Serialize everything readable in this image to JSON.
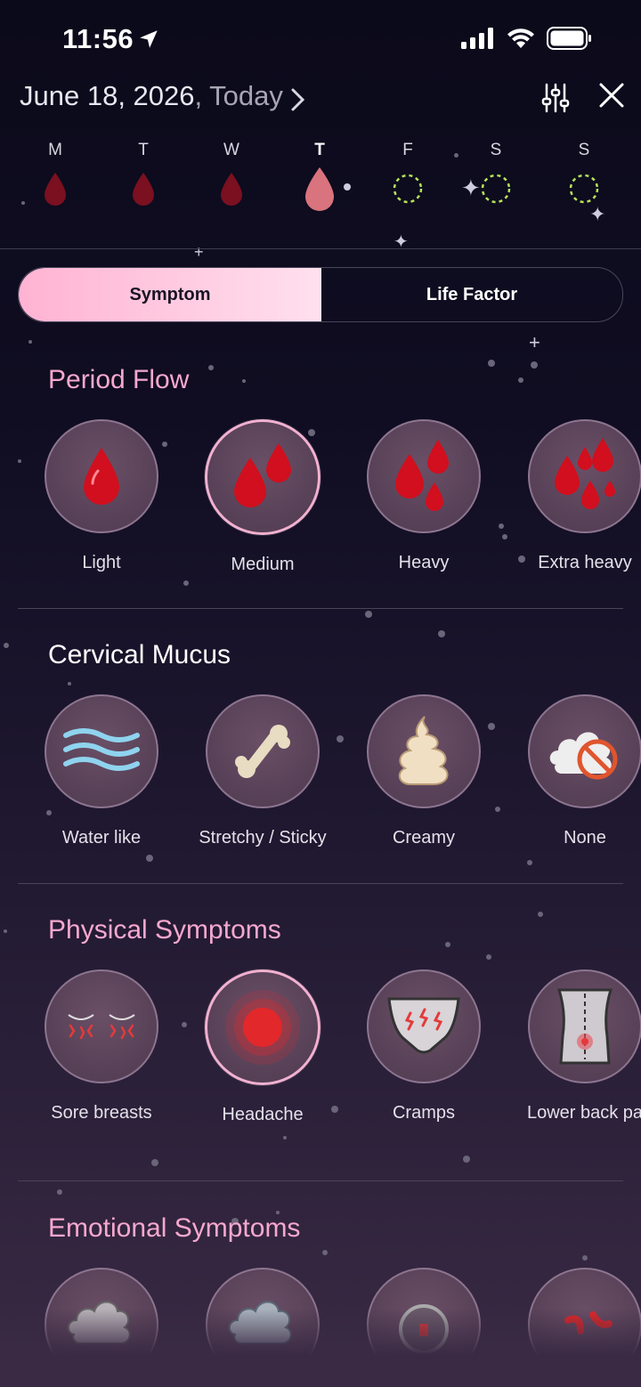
{
  "status_bar": {
    "time": "11:56"
  },
  "header": {
    "date": "June 18, 2026",
    "date_suffix": ", Today",
    "filter_icon": "sliders-icon",
    "close_icon": "close-icon"
  },
  "week": [
    {
      "letter": "M",
      "state": "period"
    },
    {
      "letter": "T",
      "state": "period"
    },
    {
      "letter": "W",
      "state": "period"
    },
    {
      "letter": "T",
      "state": "period-today"
    },
    {
      "letter": "F",
      "state": "predicted"
    },
    {
      "letter": "S",
      "state": "predicted"
    },
    {
      "letter": "S",
      "state": "predicted"
    }
  ],
  "tabs": {
    "symptom": "Symptom",
    "life_factor": "Life Factor",
    "selected": "Symptom"
  },
  "sections": {
    "period_flow": {
      "title": "Period Flow",
      "options": [
        {
          "label": "Light",
          "icon": "single-drop-icon",
          "selected": false
        },
        {
          "label": "Medium",
          "icon": "two-drops-icon",
          "selected": true
        },
        {
          "label": "Heavy",
          "icon": "three-drops-icon",
          "selected": false
        },
        {
          "label": "Extra heavy",
          "icon": "many-drops-icon",
          "selected": false
        }
      ]
    },
    "cervical_mucus": {
      "title": "Cervical Mucus",
      "options": [
        {
          "label": "Water like",
          "icon": "water-waves-icon",
          "selected": false
        },
        {
          "label": "Stretchy / Sticky",
          "icon": "stretchy-bone-icon",
          "selected": false
        },
        {
          "label": "Creamy",
          "icon": "cream-swirl-icon",
          "selected": false
        },
        {
          "label": "None",
          "icon": "no-cloud-icon",
          "selected": false
        }
      ]
    },
    "physical_symptoms": {
      "title": "Physical Symptoms",
      "options": [
        {
          "label": "Sore breasts",
          "icon": "sore-breasts-icon",
          "selected": false
        },
        {
          "label": "Headache",
          "icon": "headache-icon",
          "selected": true
        },
        {
          "label": "Cramps",
          "icon": "cramps-icon",
          "selected": false
        },
        {
          "label": "Lower back pa",
          "icon": "lower-back-icon",
          "selected": false
        }
      ]
    },
    "emotional_symptoms": {
      "title": "Emotional Symptoms",
      "options": [
        {
          "icon": "cloud-storm-icon"
        },
        {
          "icon": "cloud-rain-icon"
        },
        {
          "icon": "anxious-icon"
        },
        {
          "icon": "angry-icon"
        }
      ]
    }
  },
  "colors": {
    "accent_pink": "#f7a8cf",
    "period_red": "#8b0f1e",
    "today_drop": "#e07a86",
    "predicted_ring": "#b6e35a",
    "background_top": "#0b0a1a",
    "background_bottom": "#3a2a44"
  }
}
